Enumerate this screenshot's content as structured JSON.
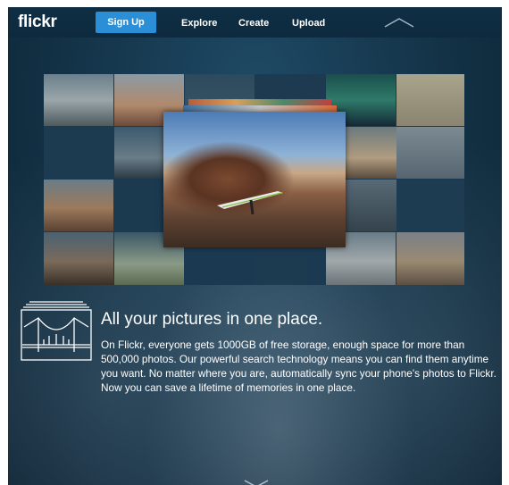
{
  "nav": {
    "logo": "flickr",
    "signup": "Sign Up",
    "items": [
      "Explore",
      "Create",
      "Upload"
    ]
  },
  "feature": {
    "headline": "All your pictures in one place.",
    "body": "On Flickr, everyone gets 1000GB of free storage, enough space for more than 500,000 photos. Our powerful search technology means you can find them anytime you want. No matter where you are, automatically sync your phone's photos to Flickr. Now you can save a lifetime of memories in one place."
  },
  "icons": {
    "scroll_up": "chevron-up-icon",
    "scroll_down": "chevron-down-icon",
    "feature": "bridge-photo-stack-icon"
  },
  "colors": {
    "signup_button": "#2a8fd6",
    "background": "#133246"
  }
}
